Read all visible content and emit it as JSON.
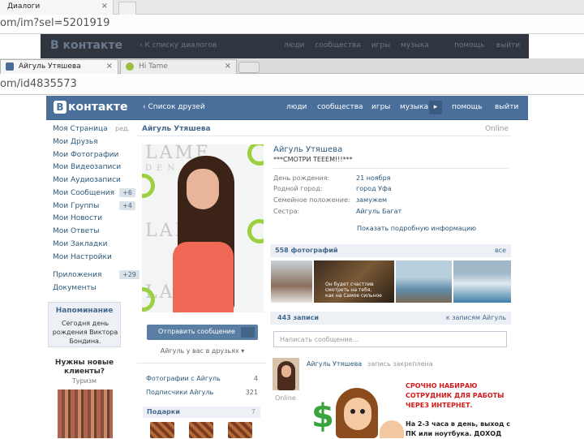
{
  "back_window": {
    "tab_title": "Диалоги",
    "url": "om/im?sel=5201919",
    "header": {
      "logo": "контакте",
      "back_link": "К списку диалогов",
      "nav": [
        "люди",
        "сообщества",
        "игры",
        "музыка"
      ],
      "nav_right": [
        "помощь",
        "выйти"
      ]
    }
  },
  "browser": {
    "tabs": [
      {
        "title": "Айгуль Утяшева"
      },
      {
        "title": "Hi Tame"
      }
    ],
    "url": "om/id4835573"
  },
  "vk_header": {
    "logo": "контакте",
    "logo_letter": "В",
    "back_link": "Список друзей",
    "nav": [
      "люди",
      "сообщества",
      "игры",
      "музыка"
    ],
    "more": "▸",
    "nav_right": [
      "помощь",
      "выйти"
    ]
  },
  "sidebar": {
    "items": [
      {
        "label": "Моя Страница",
        "extra": "ред."
      },
      {
        "label": "Мои Друзья"
      },
      {
        "label": "Мои Фотографии"
      },
      {
        "label": "Мои Видеозаписи"
      },
      {
        "label": "Мои Аудиозаписи"
      },
      {
        "label": "Мои Сообщения",
        "badge": "+6"
      },
      {
        "label": "Мои Группы",
        "badge": "+4"
      },
      {
        "label": "Мои Новости"
      },
      {
        "label": "Мои Ответы"
      },
      {
        "label": "Мои Закладки"
      },
      {
        "label": "Мои Настройки"
      },
      {
        "label": "Приложения",
        "badge": "+29"
      },
      {
        "label": "Документы"
      }
    ],
    "reminder": {
      "title": "Напоминание",
      "body": "Сегодня день рождения Виктора Бондина."
    },
    "ad": {
      "title": "Нужны новые клиенты?",
      "subtitle": "Туризм"
    }
  },
  "profile": {
    "name_bar": "Айгуль Утяшева",
    "status_online": "Online",
    "photo_text": {
      "brand": "LAME",
      "sub": "DEN"
    },
    "message_button": "Отправить сообщение",
    "friends_button": "Айгуль у вас в друзьях",
    "stats": [
      {
        "label": "Фотографии с Айгуль",
        "value": "4"
      },
      {
        "label": "Подписчики Айгуль",
        "value": "321"
      }
    ],
    "gifts": {
      "title": "Подарки",
      "count": "7"
    }
  },
  "info": {
    "name": "Айгуль Утяшева",
    "status": "***СМОТРИ ТЕЕЕМ!!!***",
    "rows": [
      {
        "key": "День рождения:",
        "value": "21 ноября"
      },
      {
        "key": "Родной город:",
        "value": "город Уфа"
      },
      {
        "key": "Семейное положение:",
        "value": "замужем"
      },
      {
        "key": "Сестра:",
        "value": "Айгуль Багат"
      }
    ],
    "more_link": "Показать подробную информацию"
  },
  "photos": {
    "title": "558 фотографий",
    "all_link": "все",
    "thumb_caption": "Он будет счастлив смотреть на тебя, как на Самое сильное"
  },
  "wall": {
    "title": "443 записи",
    "link": "к записям Айгуль",
    "placeholder": "Написать сообщение...",
    "post": {
      "author": "Айгуль Утяшева",
      "note": "запись закреплена",
      "online": "Online",
      "promo_red": [
        "СРОЧНО НАБИРАЮ",
        "СОТРУДНИК ДЛЯ РАБОТЫ",
        "ЧЕРЕЗ ИНТЕРНЕТ."
      ],
      "promo_black": [
        "На 2-3 часа в день, выход с",
        "ПК или ноутбука. ДОХОД"
      ],
      "dollar": "$"
    }
  },
  "colors": {
    "vk_blue": "#4a6f9a",
    "link": "#2b587a",
    "promo_red": "#d21919"
  }
}
